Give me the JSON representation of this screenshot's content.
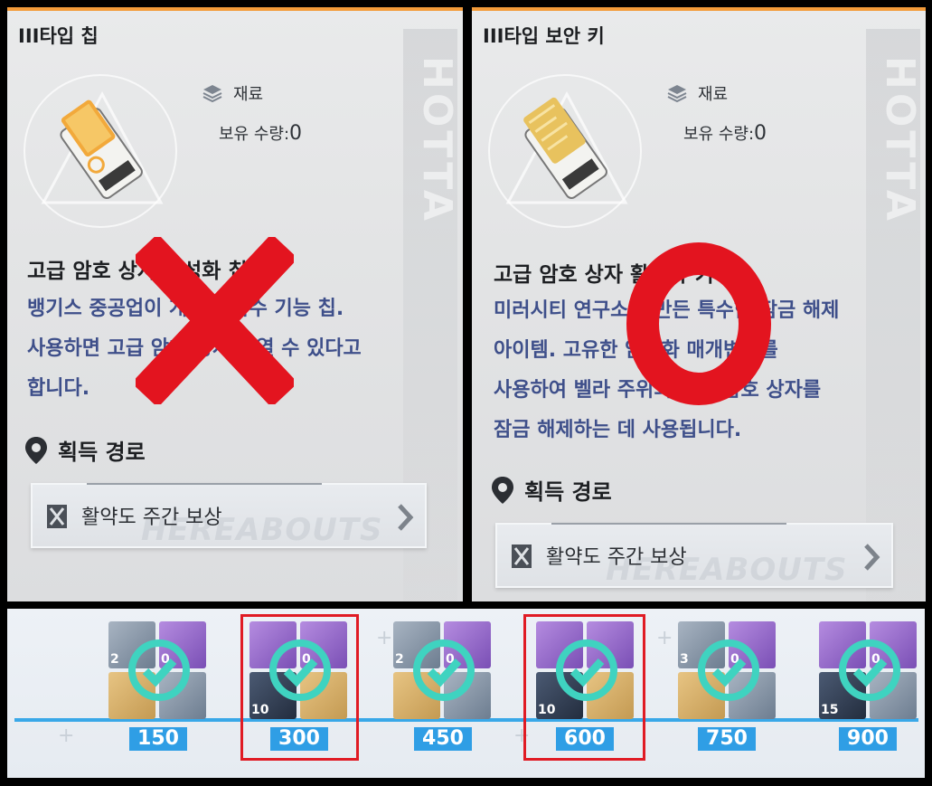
{
  "left_panel": {
    "title": "III타입 칩",
    "type_label": "재료",
    "owned_label": "보유 수량:",
    "owned_value": "0",
    "name": "고급 암호 상자 활성화 칩",
    "description_lines": [
      "뱅기스 중공업이 개발한 특수 기능 칩.",
      "사용하면 고급 암호 상자를 열 수 있다고",
      "합니다."
    ],
    "route_heading": "획득 경로",
    "route_label": "활약도 주간 보상",
    "watermark": "HOTTA",
    "ghost_text": "HEREABOUTS",
    "verdict_mark": "X",
    "verdict_color": "#e3141f"
  },
  "right_panel": {
    "title": "III타입 보안 키",
    "type_label": "재료",
    "owned_label": "보유 수량:",
    "owned_value": "0",
    "name": "고급 암호 상자 활성화 키",
    "description_lines": [
      "미러시티 연구소가 만든 특수한 잠금 해제",
      "아이템. 고유한 암호화 매개변수를",
      "사용하여 벨라 주위의 고급 암호 상자를",
      "잠금 해제하는 데 사용됩니다."
    ],
    "route_heading": "획득 경로",
    "route_label": "활약도 주간 보상",
    "watermark": "HOTTA",
    "ghost_text": "HEREABOUTS",
    "verdict_mark": "O",
    "verdict_color": "#e3141f"
  },
  "reward_track": {
    "accent": "#39a8e8",
    "check_color": "#3fd3c0",
    "milestones": [
      {
        "value": "150",
        "qty_a": "2",
        "qty_b": "0",
        "qty_c": "",
        "highlighted": false
      },
      {
        "value": "300",
        "qty_a": "",
        "qty_b": "0",
        "qty_c": "10",
        "highlighted": true
      },
      {
        "value": "450",
        "qty_a": "2",
        "qty_b": "0",
        "qty_c": "",
        "highlighted": false
      },
      {
        "value": "600",
        "qty_a": "",
        "qty_b": "",
        "qty_c": "10",
        "highlighted": true
      },
      {
        "value": "750",
        "qty_a": "3",
        "qty_b": "0",
        "qty_c": "",
        "highlighted": false
      },
      {
        "value": "900",
        "qty_a": "",
        "qty_b": "0",
        "qty_c": "15",
        "highlighted": false
      }
    ]
  }
}
